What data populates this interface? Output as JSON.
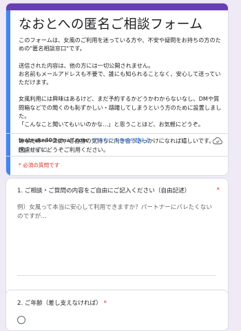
{
  "form": {
    "title": "なおとへの匿名ご相談フォーム",
    "description": "このフォームは、女風のご利用を迷っている方や、不安や疑問をお持ちの方のための\"匿名相談窓口\"です。\n\n送信された内容は、他の方には一切公開されません。\nお名前もメールアドレスも不要で、誰にも知られることなく、安心して送っていただけます。\n\n女風利用には興味はあるけど、まだ予約するかどうかわからないなし、DMや質問箱などでの聞くのも恥ずかしい・躊躇してしまうという方のために設置しました。\n「こんなこと聞いてもいいのかな…」と思うことほど、お気軽にどうぞ。\n\nあなたのペースで、ご自身の気持ちに向き合うきっかけになれば嬉しいです。\n遠慮せずにどうぞご利用ください。"
  },
  "account": {
    "email": "teabrake40@gmail.com",
    "switch_label": "アカウントを切り替える",
    "shared_label": "共有なし",
    "cloud_icon": "cloud-saved-icon",
    "shared_icon": "not-shared-icon"
  },
  "required_note": "* 必須の質問です",
  "questions": [
    {
      "title": "1. ご相談・ご質問の内容をご自由にご記入ください（自由記述）",
      "required_mark": "*",
      "placeholder": "例）女風って本当に安心して利用できますか？パートナーにバレたくないのですが…"
    },
    {
      "title": "2. ご年齢（差し支えなければ）",
      "required_mark": "*",
      "option_first": ""
    }
  ],
  "colors": {
    "background": "#efeaf6",
    "accent_purple": "#6a3fb5",
    "accent_blue": "#4285f4",
    "required_red": "#d93025",
    "link_blue": "#1a73e8"
  }
}
